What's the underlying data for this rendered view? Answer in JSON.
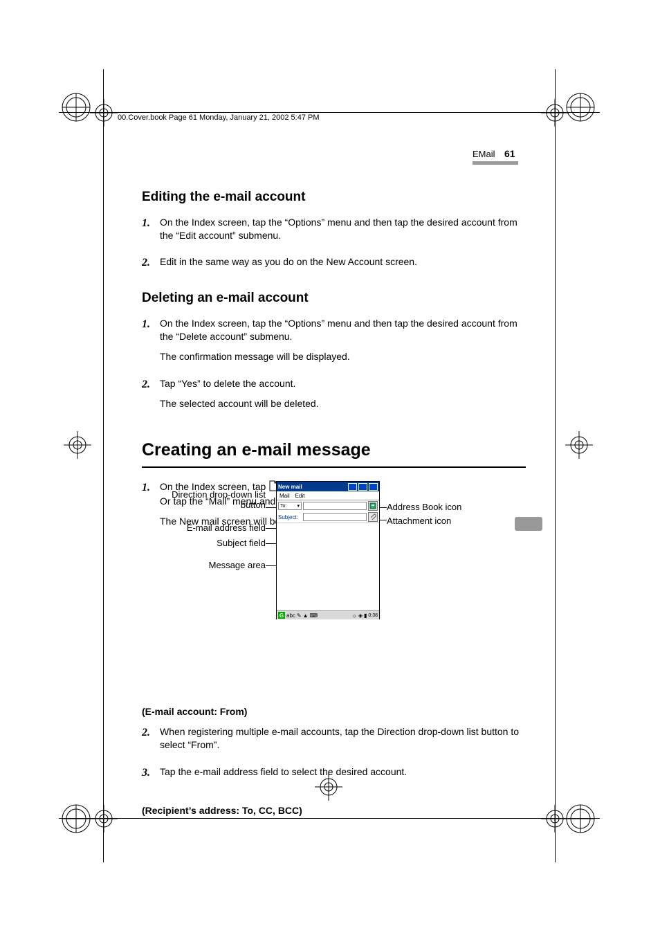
{
  "header": {
    "running": "00.Cover.book  Page 61  Monday, January 21, 2002  5:47 PM",
    "chapter": "EMail",
    "page_number": "61"
  },
  "sections": {
    "edit": {
      "title": "Editing the e-mail account",
      "steps": [
        "On the Index screen, tap the “Options” menu and then tap the desired account from the “Edit account” submenu.",
        "Edit in the same way as you do on the New Account screen."
      ]
    },
    "delete": {
      "title": "Deleting an e-mail account",
      "steps": [
        {
          "text": "On the Index screen, tap the “Options” menu and then tap the desired account from the “Delete account” submenu.",
          "after": "The confirmation message will be displayed."
        },
        {
          "text": "Tap “Yes” to delete the account.",
          "after": "The selected account will be deleted."
        }
      ]
    },
    "create": {
      "title": "Creating an e-mail message",
      "step1_a": "On the Index screen, tap ",
      "step1_b": ".",
      "step1_c": "Or tap the “Mail” menu and then tap “New mail”.",
      "step1_after": "The New mail screen will be displayed.",
      "from": {
        "title": "(E-mail account: From)",
        "step2": "When registering multiple e-mail accounts, tap the Direction drop-down list button to select “From”.",
        "step3": "Tap the e-mail address field to select the desired account."
      },
      "recipient_title": "(Recipient’s address: To, CC, BCC)"
    }
  },
  "diagram": {
    "labels_left": {
      "direction": "Direction drop-down list button",
      "email_field": "E-mail address field",
      "subject_field": "Subject field",
      "message_area": "Message area"
    },
    "labels_right": {
      "address_book": "Address Book icon",
      "attachment": "Attachment icon"
    },
    "pda": {
      "title": "New mail",
      "menu": {
        "mail": "Mail",
        "edit": "Edit"
      },
      "to_label": "To:",
      "subject_label": "Subject:",
      "taskbar": {
        "g": "G",
        "time": "0:38"
      }
    }
  }
}
